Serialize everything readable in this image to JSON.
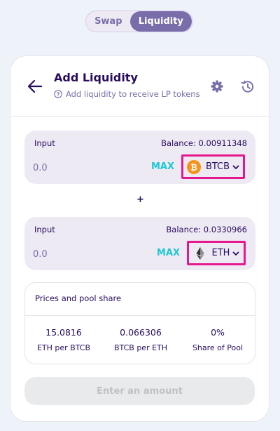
{
  "tabs": [
    {
      "label": "Swap",
      "active": false
    },
    {
      "label": "Liquidity",
      "active": true
    }
  ],
  "header": {
    "title": "Add Liquidity",
    "subtitle": "Add liquidity to receive LP tokens",
    "icons": [
      "back-arrow-icon",
      "help-circle-icon",
      "gear-icon",
      "history-icon"
    ]
  },
  "input_a": {
    "label": "Input",
    "balance": "Balance: 0.00911348",
    "placeholder": "0.0",
    "max_label": "MAX",
    "token": "BTCB",
    "token_icon": "bitcoin-icon"
  },
  "plus": "+",
  "input_b": {
    "label": "Input",
    "balance": "Balance: 0.0330966",
    "placeholder": "0.0",
    "max_label": "MAX",
    "token": "ETH",
    "token_icon": "ethereum-icon"
  },
  "prices": {
    "title": "Prices and pool share",
    "stats": [
      {
        "value": "15.0816",
        "label": "ETH per BTCB"
      },
      {
        "value": "0.066306",
        "label": "BTCB per ETH"
      },
      {
        "value": "0%",
        "label": "Share of Pool"
      }
    ]
  },
  "submit_label": "Enter an amount",
  "colors": {
    "accent": "#7a6eaa",
    "text": "#280d5f",
    "max": "#1fc7d4",
    "highlight_border": "#e5198f",
    "bitcoin": "#f7931a"
  }
}
